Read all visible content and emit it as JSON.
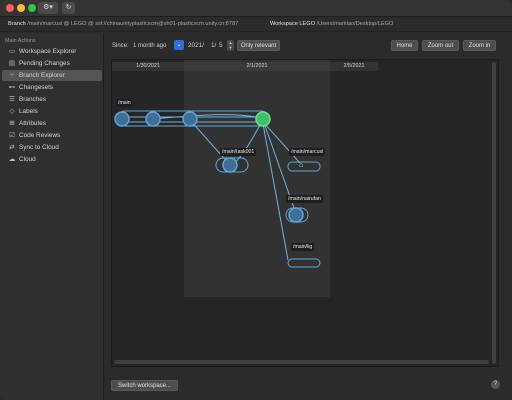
{
  "window": {
    "gear_glyph": "⚙▾",
    "refresh_glyph": "↻"
  },
  "pathbar": {
    "branch_label": "Branch",
    "branch_value": "/main/marcusl @ LEGO @ ssl://chinaunityplasticscm@sh01-plasticscm.unity.cn:8787",
    "workspace_label": "Workspace LEGO",
    "workspace_value": "/Users/marklao/Desktop/LEGO"
  },
  "sidebar": {
    "header": "Main Actions",
    "items": [
      {
        "label": "Workspace Explorer",
        "icon": "folder-icon",
        "glyph": "▭"
      },
      {
        "label": "Pending Changes",
        "icon": "pending-changes-icon",
        "glyph": "▤"
      },
      {
        "label": "Branch Explorer",
        "icon": "branch-explorer-icon",
        "glyph": "⑂"
      },
      {
        "label": "Changesets",
        "icon": "changesets-icon",
        "glyph": "⊷"
      },
      {
        "label": "Branches",
        "icon": "branches-icon",
        "glyph": "☰"
      },
      {
        "label": "Labels",
        "icon": "labels-icon",
        "glyph": "◇"
      },
      {
        "label": "Attributes",
        "icon": "attributes-icon",
        "glyph": "⊞"
      },
      {
        "label": "Code Reviews",
        "icon": "code-reviews-icon",
        "glyph": "☑"
      },
      {
        "label": "Sync to Cloud",
        "icon": "sync-icon",
        "glyph": "⇄"
      },
      {
        "label": "Cloud",
        "icon": "cloud-icon",
        "glyph": "☁"
      }
    ],
    "selected_index": 2
  },
  "toolbar": {
    "since_label": "Since:",
    "since_value": "1 month ago",
    "dropdown_glyph": "⌄",
    "date_year": "2021/",
    "date_month": "1/",
    "date_day": "5",
    "stepper_up": "▲",
    "stepper_down": "▼",
    "only_relevant": "Only relevant",
    "home": "Home",
    "zoom_out": "Zoom out",
    "zoom_in": "Zoom in"
  },
  "graph": {
    "dates": [
      "1/30/2021",
      "2/1/2021",
      "2/5/2021"
    ],
    "branches": [
      "/main",
      "/main/task001",
      "/main/marcusl",
      "/main/nairufan",
      "/main/lig"
    ],
    "home_glyph": "⌂",
    "colors": {
      "node_blue": "#5ea8d8",
      "node_fill": "#3f6f96",
      "node_green": "#3cc06a",
      "edge": "#6fb3e0"
    }
  },
  "bottom": {
    "switch_workspace": "Switch workspace...",
    "help": "?"
  }
}
